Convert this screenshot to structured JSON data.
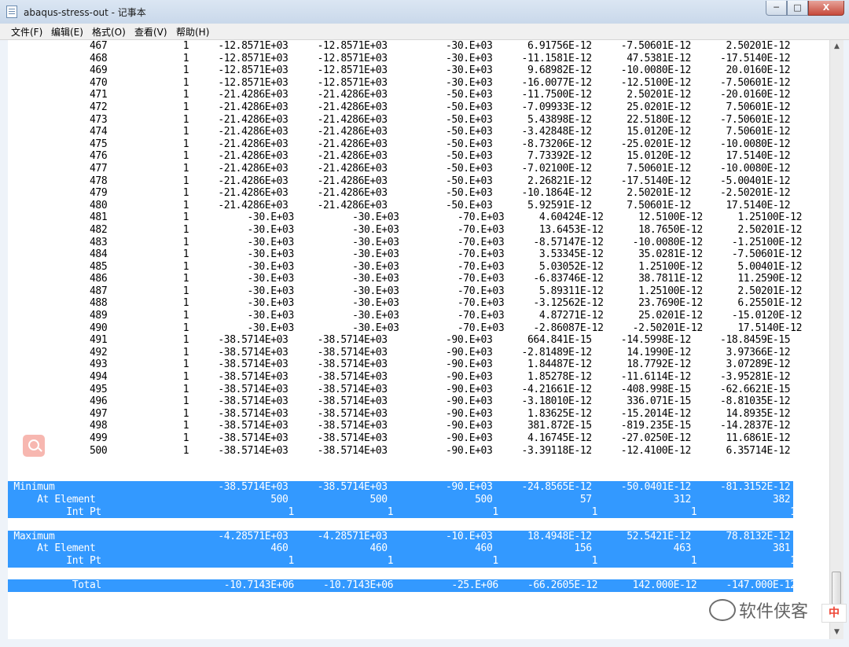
{
  "window": {
    "title": "abaqus-stress-out - 记事本"
  },
  "menu": [
    {
      "label": "文件(F)"
    },
    {
      "label": "编辑(E)"
    },
    {
      "label": "格式(O)"
    },
    {
      "label": "查看(V)"
    },
    {
      "label": "帮助(H)"
    }
  ],
  "controls": {
    "minimize": "─",
    "maximize": "□",
    "close": "X"
  },
  "rows": [
    "              467             1     -12.8571E+03     -12.8571E+03          -30.E+03      6.91756E-12     -7.50601E-12      2.50201E-12",
    "              468             1     -12.8571E+03     -12.8571E+03          -30.E+03     -11.1581E-12      47.5381E-12     -17.5140E-12",
    "              469             1     -12.8571E+03     -12.8571E+03          -30.E+03      9.68982E-12     -10.0080E-12      20.0160E-12",
    "              470             1     -12.8571E+03     -12.8571E+03          -30.E+03     -16.0077E-12     -12.5100E-12     -7.50601E-12",
    "              471             1     -21.4286E+03     -21.4286E+03          -50.E+03     -11.7500E-12      2.50201E-12     -20.0160E-12",
    "              472             1     -21.4286E+03     -21.4286E+03          -50.E+03     -7.09933E-12      25.0201E-12      7.50601E-12",
    "              473             1     -21.4286E+03     -21.4286E+03          -50.E+03      5.43898E-12      22.5180E-12     -7.50601E-12",
    "              474             1     -21.4286E+03     -21.4286E+03          -50.E+03     -3.42848E-12      15.0120E-12      7.50601E-12",
    "              475             1     -21.4286E+03     -21.4286E+03          -50.E+03     -8.73206E-12     -25.0201E-12     -10.0080E-12",
    "              476             1     -21.4286E+03     -21.4286E+03          -50.E+03      7.73392E-12      15.0120E-12      17.5140E-12",
    "              477             1     -21.4286E+03     -21.4286E+03          -50.E+03     -7.02100E-12      7.50601E-12     -10.0080E-12",
    "              478             1     -21.4286E+03     -21.4286E+03          -50.E+03      2.26821E-12     -17.5140E-12     -5.00401E-12",
    "              479             1     -21.4286E+03     -21.4286E+03          -50.E+03     -10.1864E-12      2.50201E-12     -2.50201E-12",
    "              480             1     -21.4286E+03     -21.4286E+03          -50.E+03      5.92591E-12      7.50601E-12      17.5140E-12",
    "              481             1          -30.E+03          -30.E+03          -70.E+03      4.60424E-12      12.5100E-12      1.25100E-12",
    "              482             1          -30.E+03          -30.E+03          -70.E+03      13.6453E-12      18.7650E-12      2.50201E-12",
    "              483             1          -30.E+03          -30.E+03          -70.E+03     -8.57147E-12     -10.0080E-12     -1.25100E-12",
    "              484             1          -30.E+03          -30.E+03          -70.E+03      3.53345E-12      35.0281E-12     -7.50601E-12",
    "              485             1          -30.E+03          -30.E+03          -70.E+03      5.03052E-12      1.25100E-12      5.00401E-12",
    "              486             1          -30.E+03          -30.E+03          -70.E+03     -6.83746E-12      38.7811E-12      11.2590E-12",
    "              487             1          -30.E+03          -30.E+03          -70.E+03      5.89311E-12      1.25100E-12      2.50201E-12",
    "              488             1          -30.E+03          -30.E+03          -70.E+03     -3.12562E-12      23.7690E-12      6.25501E-12",
    "              489             1          -30.E+03          -30.E+03          -70.E+03      4.87271E-12      25.0201E-12     -15.0120E-12",
    "              490             1          -30.E+03          -30.E+03          -70.E+03     -2.86087E-12     -2.50201E-12      17.5140E-12",
    "              491             1     -38.5714E+03     -38.5714E+03          -90.E+03      664.841E-15     -14.5998E-12     -18.8459E-15",
    "              492             1     -38.5714E+03     -38.5714E+03          -90.E+03     -2.81489E-12      14.1990E-12      3.97366E-12",
    "              493             1     -38.5714E+03     -38.5714E+03          -90.E+03      1.84487E-12      18.7792E-12      3.07289E-12",
    "              494             1     -38.5714E+03     -38.5714E+03          -90.E+03      1.85278E-12     -11.6114E-12     -3.95281E-12",
    "              495             1     -38.5714E+03     -38.5714E+03          -90.E+03     -4.21661E-12     -408.998E-15     -62.6621E-15",
    "              496             1     -38.5714E+03     -38.5714E+03          -90.E+03     -3.18010E-12      336.071E-15     -8.81035E-12",
    "              497             1     -38.5714E+03     -38.5714E+03          -90.E+03      1.83625E-12     -15.2014E-12      14.8935E-12",
    "              498             1     -38.5714E+03     -38.5714E+03          -90.E+03      381.872E-15     -819.235E-15     -14.2837E-12",
    "              499             1     -38.5714E+03     -38.5714E+03          -90.E+03      4.16745E-12     -27.0250E-12      11.6861E-12",
    "              500             1     -38.5714E+03     -38.5714E+03          -90.E+03     -3.39118E-12     -12.4100E-12      6.35714E-12"
  ],
  "summary": {
    "minimum": [
      " Minimum                            -38.5714E+03     -38.5714E+03          -90.E+03     -24.8565E-12     -50.0401E-12     -81.3152E-12",
      "     At Element                              500              500               500               57              312              382",
      "          Int Pt                                1                1                 1                1                1                1"
    ],
    "maximum": [
      " Maximum                            -4.28571E+03     -4.28571E+03          -10.E+03      18.4948E-12      52.5421E-12      78.8132E-12",
      "     At Element                              460              460               460              156              463              381",
      "          Int Pt                                1                1                 1                1                1                1"
    ],
    "total": [
      "           Total                     -10.7143E+06     -10.7143E+06          -25.E+06     -66.2605E-12      142.000E-12     -147.000E-12"
    ]
  },
  "watermark": {
    "text": "软件侠客"
  },
  "ime": {
    "label": "中"
  }
}
